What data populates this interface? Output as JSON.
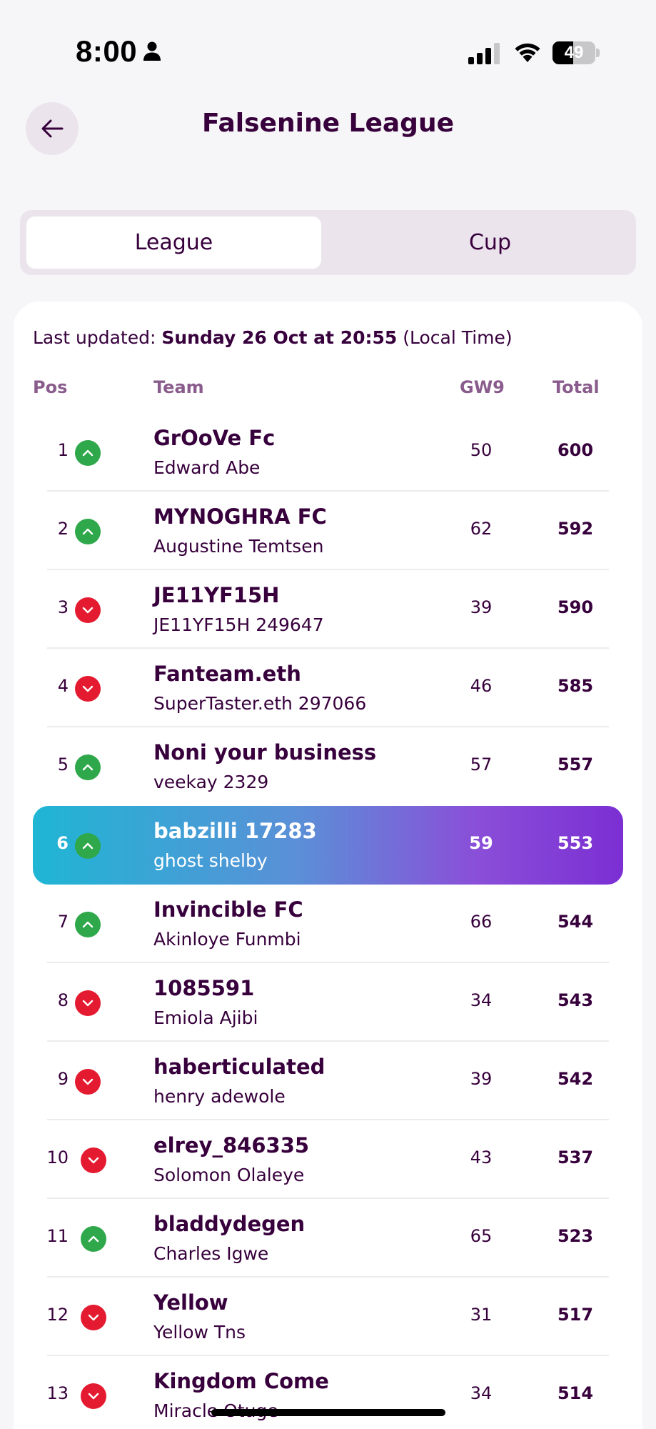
{
  "status_bar": {
    "time": "8:00",
    "battery_level": "49",
    "battery_fraction": 0.49
  },
  "header": {
    "title": "Falsenine League"
  },
  "tabs": [
    {
      "label": "League",
      "active": true
    },
    {
      "label": "Cup",
      "active": false
    }
  ],
  "last_updated": {
    "prefix": "Last updated:",
    "datetime": "Sunday 26 Oct at 20:55",
    "suffix": "(Local Time)"
  },
  "columns": {
    "pos": "Pos",
    "team": "Team",
    "gw": "GW9",
    "total": "Total"
  },
  "colors": {
    "up": "#2ea84a",
    "down": "#e41b30",
    "primary": "#37003c"
  },
  "standings": [
    {
      "pos": "1",
      "movement": "up",
      "team": "GrOoVe Fc",
      "manager": "Edward Abe",
      "gw": "50",
      "total": "600"
    },
    {
      "pos": "2",
      "movement": "up",
      "team": "MYNOGHRA FC",
      "manager": "Augustine Temtsen",
      "gw": "62",
      "total": "592"
    },
    {
      "pos": "3",
      "movement": "down",
      "team": "JE11YF15H",
      "manager": "JE11YF15H 249647",
      "gw": "39",
      "total": "590"
    },
    {
      "pos": "4",
      "movement": "down",
      "team": "Fanteam.eth",
      "manager": "SuperTaster.eth 297066",
      "gw": "46",
      "total": "585"
    },
    {
      "pos": "5",
      "movement": "up",
      "team": "Noni your business",
      "manager": "veekay 2329",
      "gw": "57",
      "total": "557"
    },
    {
      "pos": "6",
      "movement": "up",
      "team": "babzilli 17283",
      "manager": "ghost shelby",
      "gw": "59",
      "total": "553",
      "highlight": true
    },
    {
      "pos": "7",
      "movement": "up",
      "team": "Invincible FC",
      "manager": "Akinloye Funmbi",
      "gw": "66",
      "total": "544"
    },
    {
      "pos": "8",
      "movement": "down",
      "team": "1085591",
      "manager": "Emiola Ajibi",
      "gw": "34",
      "total": "543"
    },
    {
      "pos": "9",
      "movement": "down",
      "team": "haberticulated",
      "manager": "henry adewole",
      "gw": "39",
      "total": "542"
    },
    {
      "pos": "10",
      "movement": "down",
      "team": "elrey_846335",
      "manager": "Solomon Olaleye",
      "gw": "43",
      "total": "537"
    },
    {
      "pos": "11",
      "movement": "up",
      "team": "bladdydegen",
      "manager": "Charles Igwe",
      "gw": "65",
      "total": "523"
    },
    {
      "pos": "12",
      "movement": "down",
      "team": "Yellow",
      "manager": "Yellow Tns",
      "gw": "31",
      "total": "517"
    },
    {
      "pos": "13",
      "movement": "down",
      "team": "Kingdom Come",
      "manager": "Miracle Otuge",
      "gw": "34",
      "total": "514"
    }
  ]
}
